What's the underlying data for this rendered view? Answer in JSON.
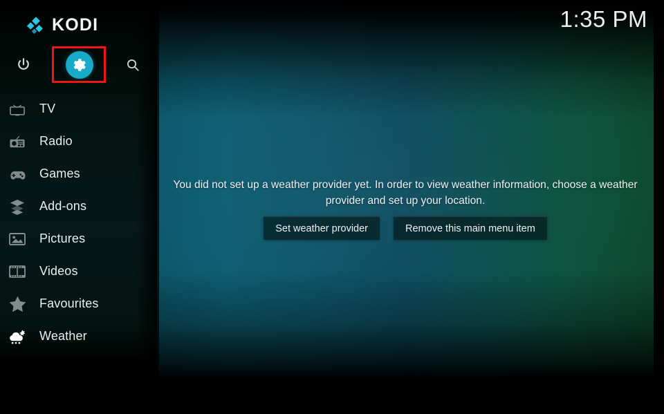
{
  "app": {
    "name": "KODI",
    "logo_icon": "kodi-logo-icon",
    "accent_color": "#19a9c9",
    "highlight_color": "#f41414"
  },
  "header": {
    "clock": "1:35 PM"
  },
  "topbar": {
    "buttons": [
      {
        "label": "Power",
        "icon": "power-icon"
      },
      {
        "label": "Settings",
        "icon": "gear-icon",
        "selected": true
      },
      {
        "label": "Search",
        "icon": "search-icon"
      }
    ]
  },
  "sidebar": {
    "items": [
      {
        "label": "TV",
        "icon": "tv-icon"
      },
      {
        "label": "Radio",
        "icon": "radio-icon"
      },
      {
        "label": "Games",
        "icon": "gamepad-icon"
      },
      {
        "label": "Add-ons",
        "icon": "addons-box-icon"
      },
      {
        "label": "Pictures",
        "icon": "pictures-icon"
      },
      {
        "label": "Videos",
        "icon": "filmstrip-icon"
      },
      {
        "label": "Favourites",
        "icon": "star-icon"
      },
      {
        "label": "Weather",
        "icon": "weather-cloud-sun-rain-icon",
        "active": true
      }
    ]
  },
  "main": {
    "notice": "You did not set up a weather provider yet. In order to view weather information, choose a weather provider and set up your location.",
    "buttons": [
      {
        "label": "Set weather provider"
      },
      {
        "label": "Remove this main menu item"
      }
    ]
  }
}
